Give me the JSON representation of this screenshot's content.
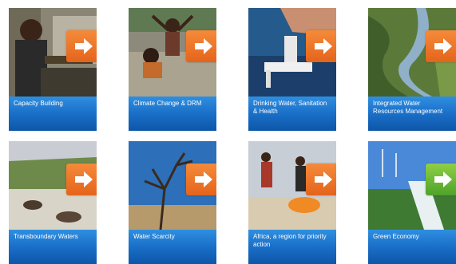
{
  "tiles": [
    {
      "label": "Capacity Building",
      "arrow_color": "#e8711f"
    },
    {
      "label": "Climate Change & DRM",
      "arrow_color": "#e8711f"
    },
    {
      "label": "Drinking Water, Sanitation & Health",
      "arrow_color": "#e8711f"
    },
    {
      "label": "Integrated Water Resources Management",
      "arrow_color": "#e8711f"
    },
    {
      "label": "Transboundary Waters",
      "arrow_color": "#e8711f"
    },
    {
      "label": "Water Scarcity",
      "arrow_color": "#e8711f"
    },
    {
      "label": "Africa, a region for priority action",
      "arrow_color": "#e8711f"
    },
    {
      "label": "Green Economy",
      "arrow_color": "#5aab2e"
    }
  ],
  "icons": {
    "arrow": "arrow-right-icon"
  },
  "colors": {
    "caption_blue": "#1a6fc8",
    "arrow_orange": "#e8711f",
    "arrow_green": "#5aab2e"
  }
}
